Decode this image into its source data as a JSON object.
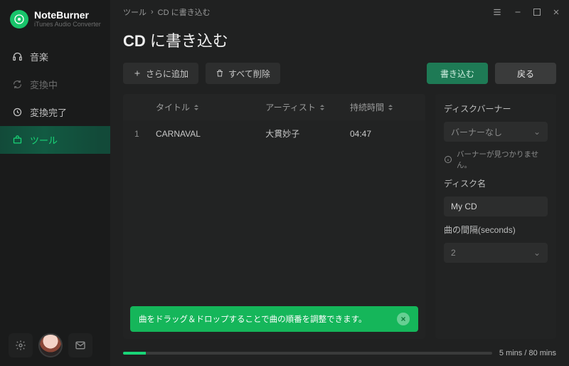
{
  "brand": {
    "title": "NoteBurner",
    "subtitle": "iTunes Audio Converter"
  },
  "sidebar": {
    "items": [
      {
        "label": "音楽"
      },
      {
        "label": "変換中"
      },
      {
        "label": "変換完了"
      },
      {
        "label": "ツール"
      }
    ]
  },
  "breadcrumb": {
    "root": "ツール",
    "current": "CD に書き込む"
  },
  "page": {
    "title_strong": "CD",
    "title_rest": " に書き込む"
  },
  "actions": {
    "add_more": "さらに追加",
    "remove_all": "すべて削除",
    "burn": "書き込む",
    "back": "戻る"
  },
  "table": {
    "headers": {
      "title": "タイトル",
      "artist": "アーティスト",
      "duration": "持続時間"
    },
    "rows": [
      {
        "idx": "1",
        "title": "CARNAVAL",
        "artist": "大貫妙子",
        "duration": "04:47"
      }
    ]
  },
  "hint": {
    "text": "曲をドラッグ＆ドロップすることで曲の順番を調整できます。"
  },
  "sidepanel": {
    "burner_label": "ディスクバーナー",
    "burner_value": "バーナーなし",
    "burner_warn": "バーナーが見つかりません。",
    "discname_label": "ディスク名",
    "discname_value": "My CD",
    "gap_label": "曲の間隔(seconds)",
    "gap_value": "2"
  },
  "progress": {
    "percent": 6.25,
    "text": "5 mins / 80 mins"
  }
}
